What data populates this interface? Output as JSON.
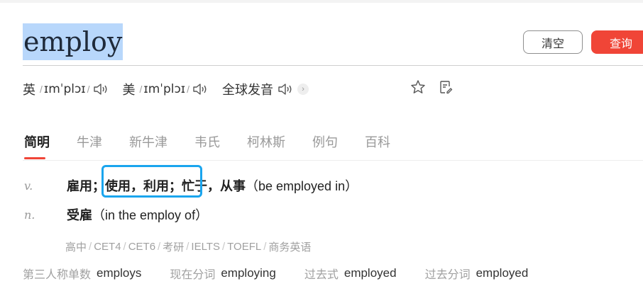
{
  "search": {
    "query": "employ",
    "clear_label": "清空",
    "submit_label": "查询"
  },
  "pronunciation": {
    "uk_label": "英",
    "uk_phonetic": "ɪmˈplɔɪ",
    "us_label": "美",
    "us_phonetic": "ɪmˈplɔɪ",
    "global_label": "全球发音"
  },
  "tabs": [
    {
      "label": "简明",
      "active": true
    },
    {
      "label": "牛津",
      "active": false
    },
    {
      "label": "新牛津",
      "active": false
    },
    {
      "label": "韦氏",
      "active": false
    },
    {
      "label": "柯林斯",
      "active": false
    },
    {
      "label": "例句",
      "active": false
    },
    {
      "label": "百科",
      "active": false
    }
  ],
  "definitions": [
    {
      "pos": "v.",
      "part1": "雇用；",
      "part2": "使用，利用；",
      "part3": "忙于，从事",
      "part4": "（be employed in）"
    },
    {
      "pos": "n.",
      "part1": "受雇",
      "part2": "（in the employ of）"
    }
  ],
  "exam_tags": [
    "高中",
    "CET4",
    "CET6",
    "考研",
    "IELTS",
    "TOEFL",
    "商务英语"
  ],
  "word_forms": [
    {
      "label": "第三人称单数",
      "value": "employs"
    },
    {
      "label": "现在分词",
      "value": "employing"
    },
    {
      "label": "过去式",
      "value": "employed"
    },
    {
      "label": "过去分词",
      "value": "employed"
    }
  ],
  "colors": {
    "accent": "#f04537",
    "highlight_border": "#1aa5ee",
    "selection": "#b8d7fb"
  }
}
